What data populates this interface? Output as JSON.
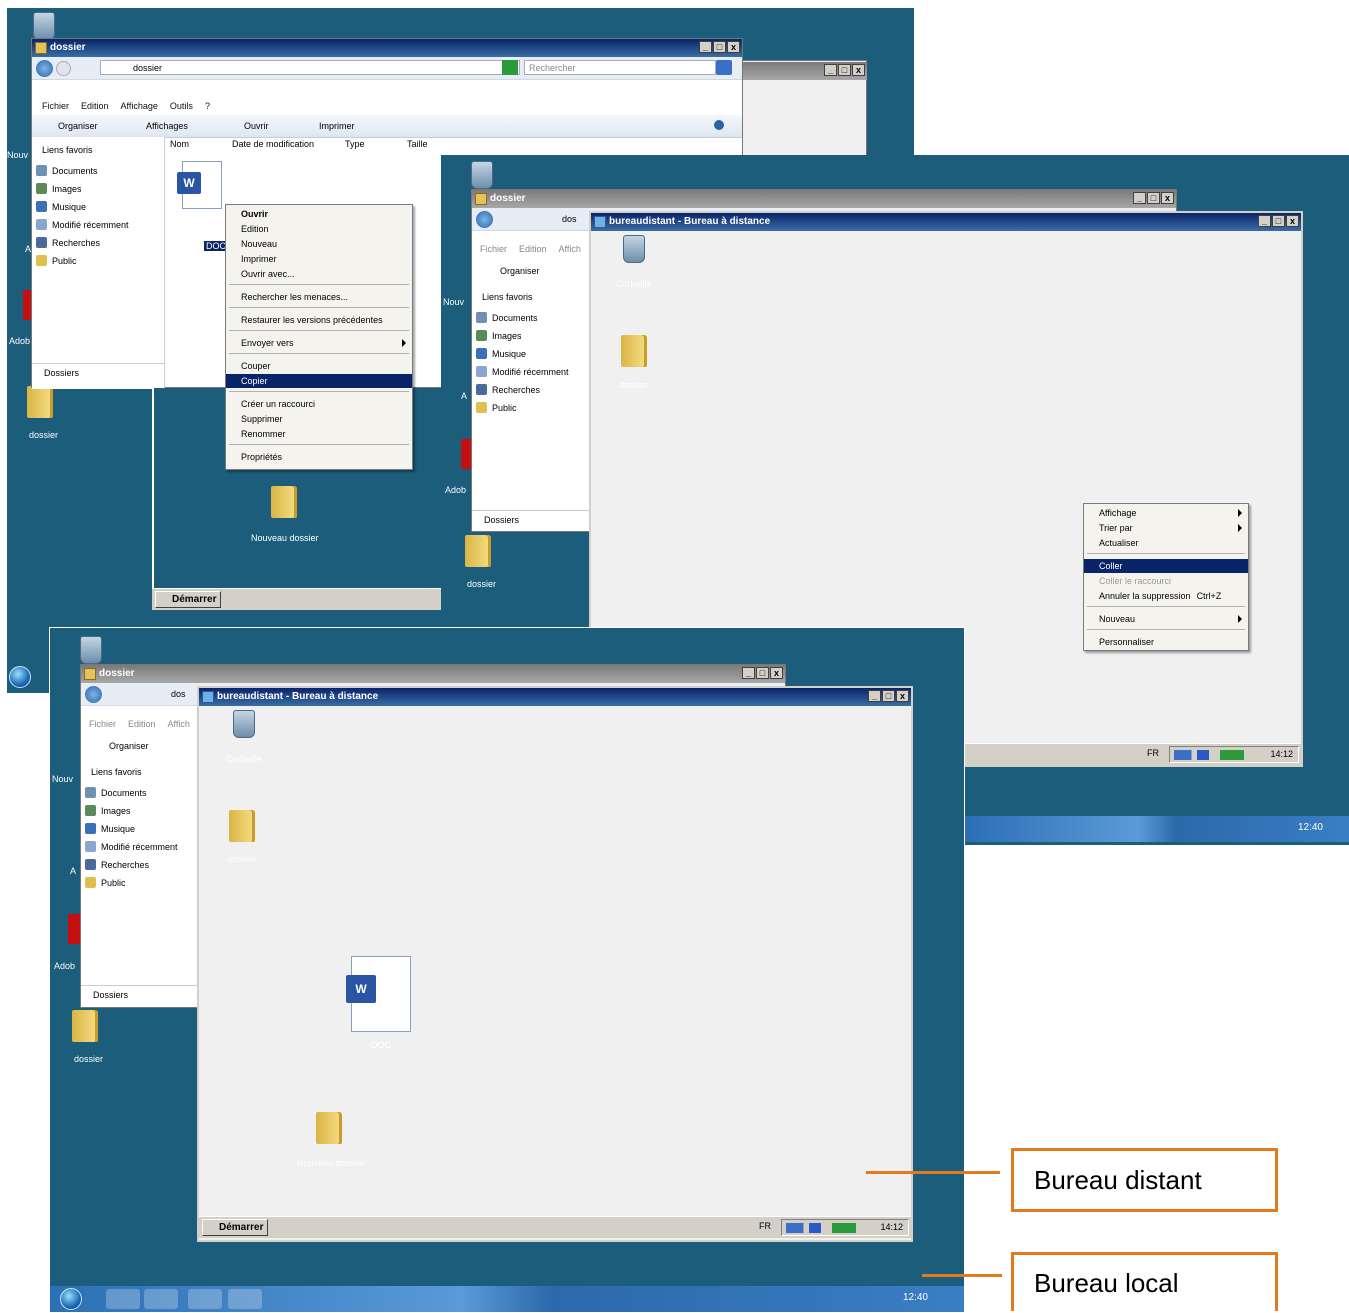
{
  "shot1": {
    "explorer_title": "dossier",
    "address_path": "dossier",
    "search_placeholder": "Rechercher",
    "menu": [
      "Fichier",
      "Edition",
      "Affichage",
      "Outils",
      "?"
    ],
    "toolbar": {
      "organize": "Organiser",
      "views": "Affichages",
      "open": "Ouvrir",
      "print": "Imprimer"
    },
    "columns": [
      "Nom",
      "Date de modification",
      "Type",
      "Taille"
    ],
    "nav_header": "Liens favoris",
    "nav_items": [
      "Documents",
      "Images",
      "Musique",
      "Modifié récemment",
      "Recherches",
      "Public"
    ],
    "folders_label": "Dossiers",
    "file_label": "DOC",
    "context_menu": [
      "Ouvrir",
      "Edition",
      "Nouveau",
      "Imprimer",
      "Ouvrir avec...",
      "Rechercher les menaces...",
      "Restaurer les versions précédentes",
      "Envoyer vers",
      "Couper",
      "Copier",
      "Créer un raccourci",
      "Supprimer",
      "Renommer",
      "Propriétés"
    ],
    "new_folder_label": "Nouveau dossier",
    "desktop_folder_label": "dossier",
    "start_label": "Démarrer",
    "desktop_edge_labels": [
      "Nouv",
      "A",
      "Adob"
    ]
  },
  "shot2": {
    "explorer_title": "dossier",
    "address_path": "dos",
    "menu": [
      "Fichier",
      "Edition",
      "Affich"
    ],
    "organize": "Organiser",
    "nav_header": "Liens favoris",
    "nav_items": [
      "Documents",
      "Images",
      "Musique",
      "Modifié récemment",
      "Recherches",
      "Public"
    ],
    "folders_label": "Dossiers",
    "rdp_title": "bureaudistant - Bureau à distance",
    "recycle_label": "Corbeille",
    "folder_label": "dossier",
    "context_menu": [
      "Affichage",
      "Trier par",
      "Actualiser",
      "Coller",
      "Coller le raccourci",
      "Annuler la suppression",
      "Nouveau",
      "Personnaliser"
    ],
    "undo_shortcut": "Ctrl+Z",
    "lang": "FR",
    "remote_clock": "14:12",
    "local_clock": "12:40",
    "desktop_folder_label": "dossier",
    "desktop_edge_labels": [
      "Nouv",
      "A",
      "Adob"
    ]
  },
  "shot3": {
    "explorer_title": "dossier",
    "address_path": "dos",
    "menu": [
      "Fichier",
      "Edition",
      "Affich"
    ],
    "organize": "Organiser",
    "nav_header": "Liens favoris",
    "nav_items": [
      "Documents",
      "Images",
      "Musique",
      "Modifié récemment",
      "Recherches",
      "Public"
    ],
    "folders_label": "Dossiers",
    "rdp_title": "bureaudistant - Bureau à distance",
    "recycle_label": "Corbeille",
    "folder_label": "dossier",
    "doc_label": "DOC",
    "new_folder_label": "Nouveau dossier",
    "start_label": "Démarrer",
    "lang": "FR",
    "remote_clock": "14:12",
    "local_clock": "12:40",
    "desktop_folder_label": "dossier",
    "desktop_edge_labels": [
      "Nouv",
      "A",
      "Adob"
    ]
  },
  "callouts": {
    "remote": "Bureau distant",
    "local": "Bureau local"
  },
  "colors": {
    "desktop": "#1b5d7b",
    "selection": "#0a246a",
    "callout": "#e37a1e"
  }
}
